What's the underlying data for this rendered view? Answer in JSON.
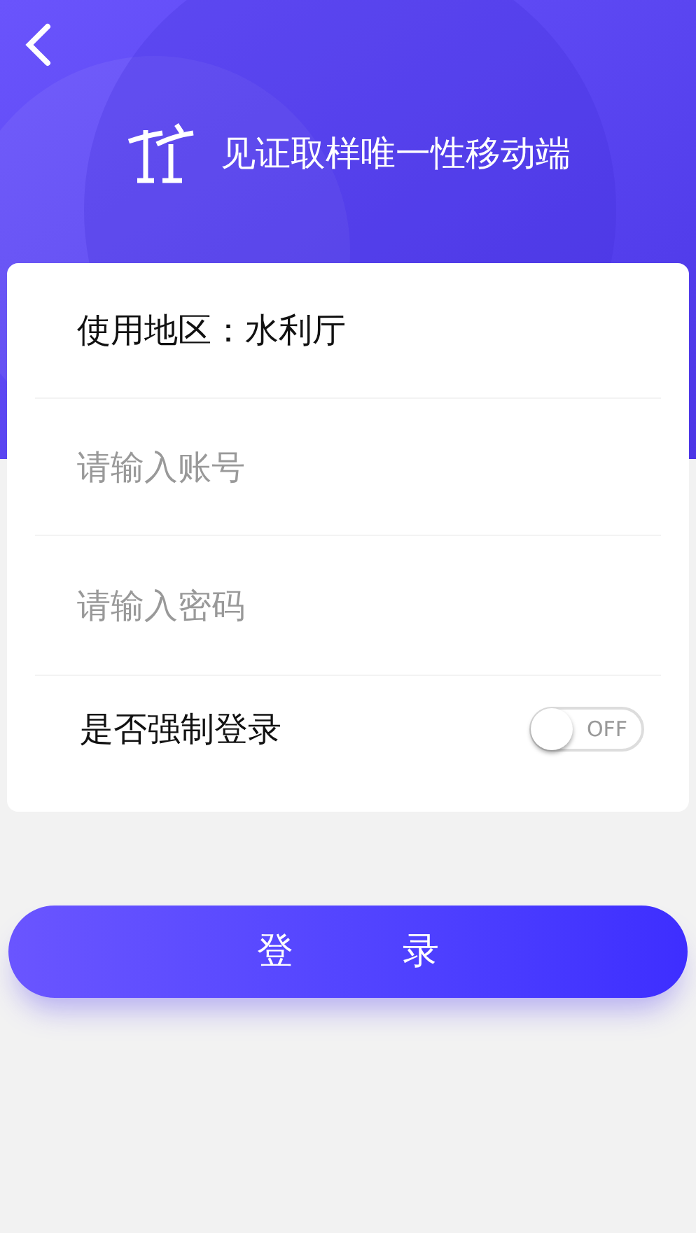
{
  "header": {
    "title": "见证取样唯一性移动端"
  },
  "form": {
    "region": {
      "label": "使用地区：",
      "value": "水利厅"
    },
    "account": {
      "placeholder": "请输入账号"
    },
    "password": {
      "placeholder": "请输入密码"
    },
    "force_login": {
      "label": "是否强制登录",
      "on": false,
      "off_text": "OFF"
    }
  },
  "login_button": "登　　　录"
}
